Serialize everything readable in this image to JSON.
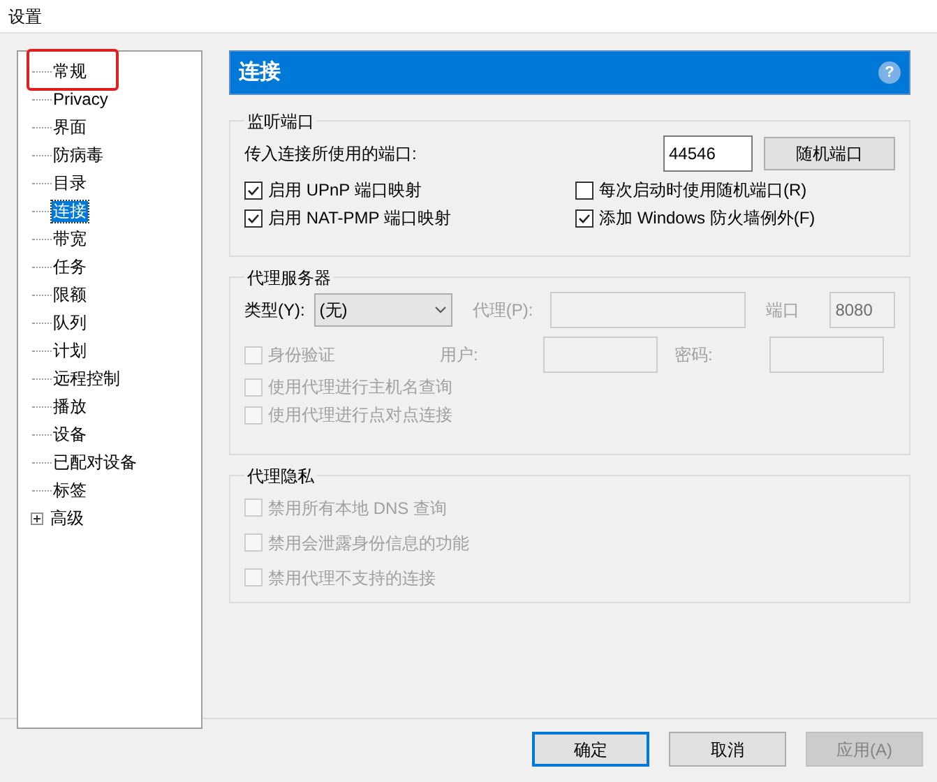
{
  "window": {
    "title": "设置"
  },
  "tree": [
    {
      "label": "常规",
      "selected": false,
      "highlighted": true
    },
    {
      "label": "Privacy",
      "selected": false,
      "highlighted": false
    },
    {
      "label": "界面",
      "selected": false,
      "highlighted": false
    },
    {
      "label": "防病毒",
      "selected": false,
      "highlighted": false
    },
    {
      "label": "目录",
      "selected": false,
      "highlighted": false
    },
    {
      "label": "连接",
      "selected": true,
      "highlighted": false
    },
    {
      "label": "带宽",
      "selected": false,
      "highlighted": false
    },
    {
      "label": "任务",
      "selected": false,
      "highlighted": false
    },
    {
      "label": "限额",
      "selected": false,
      "highlighted": false
    },
    {
      "label": "队列",
      "selected": false,
      "highlighted": false
    },
    {
      "label": "计划",
      "selected": false,
      "highlighted": false
    },
    {
      "label": "远程控制",
      "selected": false,
      "highlighted": false
    },
    {
      "label": "播放",
      "selected": false,
      "highlighted": false
    },
    {
      "label": "设备",
      "selected": false,
      "highlighted": false
    },
    {
      "label": "已配对设备",
      "selected": false,
      "highlighted": false
    },
    {
      "label": "标签",
      "selected": false,
      "highlighted": false
    },
    {
      "label": "高级",
      "selected": false,
      "highlighted": false,
      "expandable": true
    }
  ],
  "header": {
    "title": "连接",
    "help": "?"
  },
  "listen_port": {
    "title": "监听端口",
    "port_label": "传入连接所使用的端口:",
    "port_value": "44546",
    "random_button": "随机端口",
    "options": [
      {
        "label": "启用 UPnP 端口映射",
        "checked": true
      },
      {
        "label": "每次启动时使用随机端口(R)",
        "checked": false
      },
      {
        "label": "启用 NAT-PMP 端口映射",
        "checked": true
      },
      {
        "label": "添加 Windows 防火墙例外(F)",
        "checked": true
      }
    ]
  },
  "proxy_server": {
    "title": "代理服务器",
    "type_label": "类型(Y):",
    "type_value": "(无)",
    "proxy_label": "代理(P):",
    "port_label": "端口",
    "port_value": "8080",
    "auth": {
      "label": "身份验证",
      "checked": false,
      "disabled": true
    },
    "user_label": "用户:",
    "password_label": "密码:",
    "options": [
      {
        "label": "使用代理进行主机名查询",
        "checked": false,
        "disabled": true
      },
      {
        "label": "使用代理进行点对点连接",
        "checked": false,
        "disabled": true
      }
    ]
  },
  "proxy_privacy": {
    "title": "代理隐私",
    "options": [
      {
        "label": "禁用所有本地 DNS 查询",
        "checked": false,
        "disabled": true
      },
      {
        "label": "禁用会泄露身份信息的功能",
        "checked": false,
        "disabled": true
      },
      {
        "label": "禁用代理不支持的连接",
        "checked": false,
        "disabled": true
      }
    ]
  },
  "buttons": [
    {
      "label": "确定",
      "disabled": false,
      "default": true
    },
    {
      "label": "取消",
      "disabled": false,
      "default": false
    },
    {
      "label": "应用(A)",
      "disabled": true,
      "default": false
    }
  ]
}
